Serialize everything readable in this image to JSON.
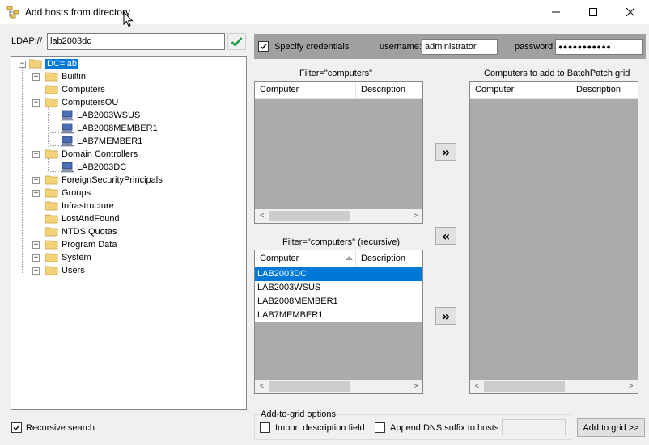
{
  "window": {
    "title": "Add hosts from directory"
  },
  "ldap": {
    "label": "LDAP://",
    "value": "lab2003dc"
  },
  "tree": {
    "root": "DC=lab",
    "nodes": [
      "Builtin",
      "Computers",
      "ComputersOU",
      "LAB2003WSUS",
      "LAB2008MEMBER1",
      "LAB7MEMBER1",
      "Domain Controllers",
      "LAB2003DC",
      "ForeignSecurityPrincipals",
      "Groups",
      "Infrastructure",
      "LostAndFound",
      "NTDS Quotas",
      "Program Data",
      "System",
      "Users"
    ]
  },
  "credentials": {
    "specify_label": "Specify credentials",
    "username_label": "username:",
    "username_value": "administrator",
    "password_label": "password:",
    "password_value": "●●●●●●●●●●●"
  },
  "list1": {
    "title": "Filter=\"computers\"",
    "col_computer": "Computer",
    "col_description": "Description"
  },
  "list2": {
    "title": "Filter=\"computers\" (recursive)",
    "col_computer": "Computer",
    "col_description": "Description",
    "rows": [
      "LAB2003DC",
      "LAB2003WSUS",
      "LAB2008MEMBER1",
      "LAB7MEMBER1"
    ]
  },
  "list3": {
    "title": "Computers to add to BatchPatch grid",
    "col_computer": "Computer",
    "col_description": "Description"
  },
  "buttons": {
    "add_right": "»",
    "remove_left": "«",
    "add_right2": "»",
    "add_to_grid": "Add to grid >>"
  },
  "options": {
    "group_label": "Add-to-grid options",
    "import_desc": "Import description field",
    "append_dns": "Append DNS suffix to hosts:",
    "dns_suffix_value": ""
  },
  "recursive": {
    "label": "Recursive search"
  },
  "colors": {
    "selection": "#0078d7",
    "check_green": "#1e9e3a"
  }
}
